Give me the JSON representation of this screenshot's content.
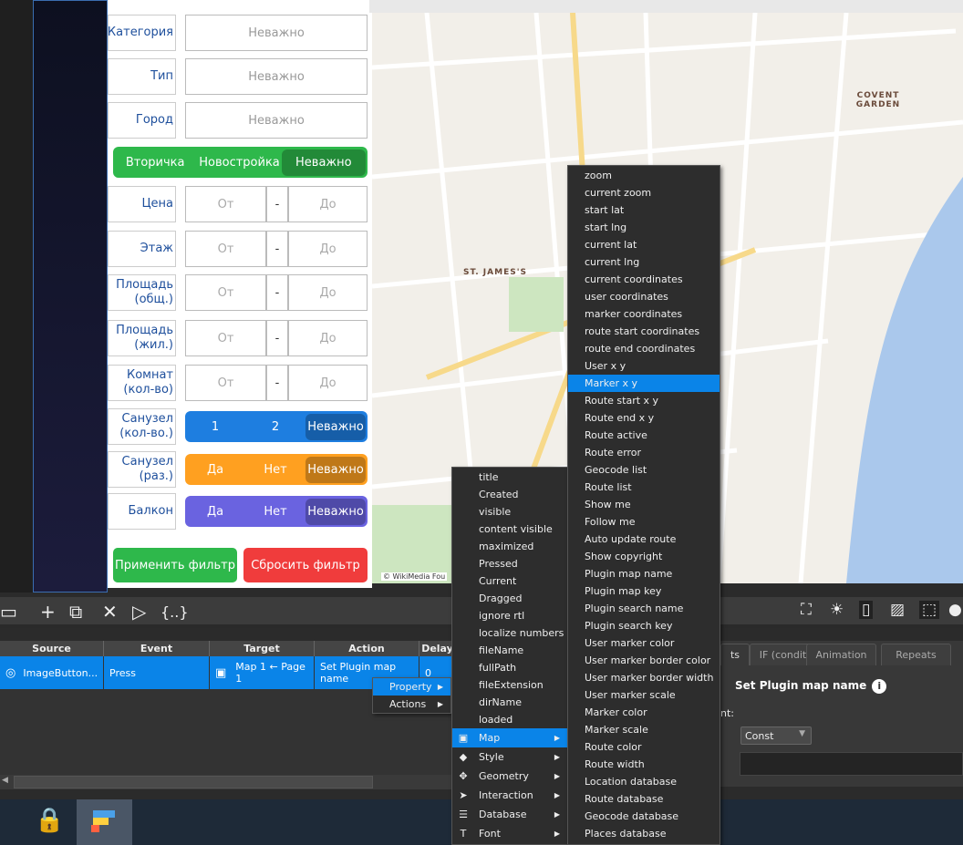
{
  "filter": {
    "rows": [
      {
        "label": "Категория",
        "value": "Неважно"
      },
      {
        "label": "Тип",
        "value": "Неважно"
      },
      {
        "label": "Город",
        "value": "Неважно"
      }
    ],
    "market": {
      "options": [
        "Вторичка",
        "Новостройка",
        "Неважно"
      ],
      "selected": "Неважно",
      "color": "#2eb84b"
    },
    "ranges": [
      {
        "label": "Цена",
        "from": "От",
        "sep": "-",
        "to": "До"
      },
      {
        "label": "Этаж",
        "from": "От",
        "sep": "-",
        "to": "До"
      },
      {
        "label": "Площадь (общ.)",
        "from": "От",
        "sep": "-",
        "to": "До"
      },
      {
        "label": "Площадь (жил.)",
        "from": "От",
        "sep": "-",
        "to": "До"
      },
      {
        "label": "Комнат (кол-во)",
        "from": "От",
        "sep": "-",
        "to": "До"
      }
    ],
    "toggles": [
      {
        "label": "Санузел (кол-во.)",
        "options": [
          "1",
          "2",
          "Неважно"
        ],
        "color": "#1e7ee0"
      },
      {
        "label": "Санузел (раз.)",
        "options": [
          "Да",
          "Нет",
          "Неважно"
        ],
        "color": "#ffa020"
      },
      {
        "label": "Балкон",
        "options": [
          "Да",
          "Нет",
          "Неважно"
        ],
        "color": "#6a63e0"
      }
    ],
    "apply_label": "Применить фильтр",
    "reset_label": "Сбросить фильтр"
  },
  "map": {
    "labels": [
      "COVENT GARDEN",
      "ST. JAMES'S"
    ],
    "copyright": "© WikiMedia Fou"
  },
  "table": {
    "headers": [
      "Source",
      "Event",
      "Target",
      "Action",
      "Delay"
    ],
    "row": {
      "source": "ImageButton...",
      "event": "Press",
      "target": "Map 1 ← Page 1",
      "action": "Set Plugin map name",
      "delay": "0"
    }
  },
  "right_panel": {
    "tabs": [
      "ts",
      "IF (condition)",
      "Animation",
      "Repeats"
    ],
    "title": "Set Plugin map name",
    "field_label": "nt:",
    "select_value": "Const"
  },
  "context_menu": {
    "items": [
      {
        "label": "Property",
        "highlighted": true
      },
      {
        "label": "Actions"
      }
    ]
  },
  "property_menu": {
    "items": [
      "title",
      "Created",
      "visible",
      "content visible",
      "maximized",
      "Pressed",
      "Current",
      "Dragged",
      "ignore rtl",
      "localize numbers",
      "fileName",
      "fullPath",
      "fileExtension",
      "dirName",
      "loaded"
    ],
    "groups": [
      {
        "label": "Map",
        "icon": "map-icon",
        "highlighted": true
      },
      {
        "label": "Style",
        "icon": "paint-bucket-icon"
      },
      {
        "label": "Geometry",
        "icon": "move-icon"
      },
      {
        "label": "Interaction",
        "icon": "cursor-icon"
      },
      {
        "label": "Database",
        "icon": "database-icon"
      },
      {
        "label": "Font",
        "icon": "font-icon"
      }
    ]
  },
  "map_menu": {
    "items": [
      "zoom",
      "current zoom",
      "start lat",
      "start lng",
      "current lat",
      "current lng",
      "current coordinates",
      "user coordinates",
      "marker coordinates",
      "route start coordinates",
      "route end coordinates",
      "User x y",
      "Marker x y",
      "Route start x y",
      "Route end x y",
      "Route active",
      "Route error",
      "Geocode list",
      "Route list",
      "Show me",
      "Follow me",
      "Auto update route",
      "Show copyright",
      "Plugin map name",
      "Plugin map key",
      "Plugin search name",
      "Plugin search key",
      "User marker color",
      "User marker border color",
      "User marker border width",
      "User marker scale",
      "Marker color",
      "Marker scale",
      "Route color",
      "Route width",
      "Location database",
      "Route database",
      "Geocode database",
      "Places database"
    ],
    "highlighted": "Marker x y"
  },
  "colors": {
    "accent": "#0a84e8",
    "apply": "#2eb84b",
    "reset": "#f03c3c"
  }
}
